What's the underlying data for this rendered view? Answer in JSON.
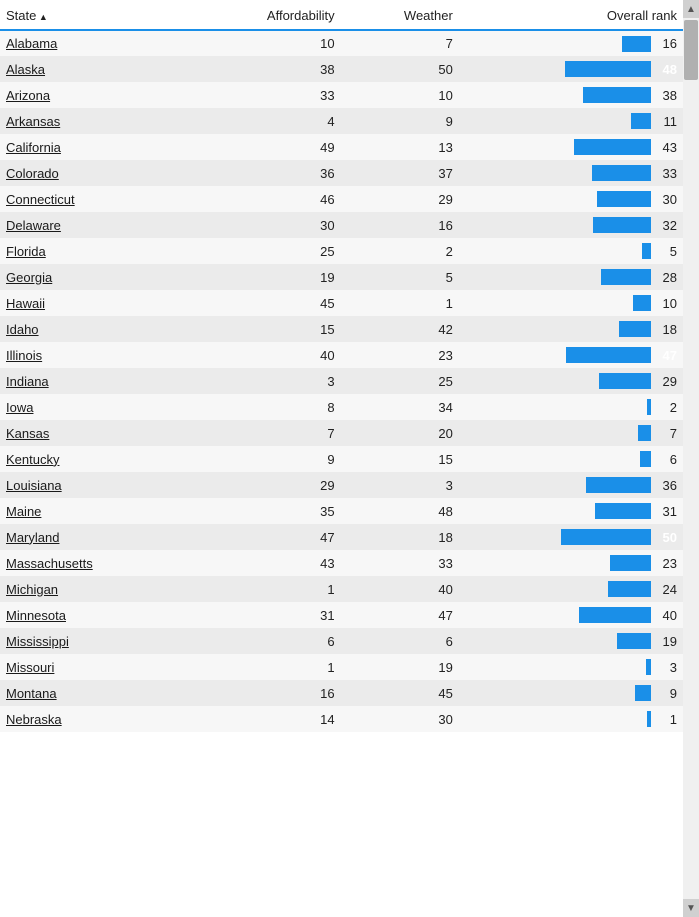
{
  "header": {
    "state_col": "State",
    "affordability_col": "Affordability",
    "weather_col": "Weather",
    "overall_col": "Overall rank"
  },
  "rows": [
    {
      "state": "Alabama",
      "affordability": 10,
      "weather": 7,
      "rank": 16
    },
    {
      "state": "Alaska",
      "affordability": 38,
      "weather": 50,
      "rank": 48
    },
    {
      "state": "Arizona",
      "affordability": 33,
      "weather": 10,
      "rank": 38
    },
    {
      "state": "Arkansas",
      "affordability": 4,
      "weather": 9,
      "rank": 11
    },
    {
      "state": "California",
      "affordability": 49,
      "weather": 13,
      "rank": 43
    },
    {
      "state": "Colorado",
      "affordability": 36,
      "weather": 37,
      "rank": 33
    },
    {
      "state": "Connecticut",
      "affordability": 46,
      "weather": 29,
      "rank": 30
    },
    {
      "state": "Delaware",
      "affordability": 30,
      "weather": 16,
      "rank": 32
    },
    {
      "state": "Florida",
      "affordability": 25,
      "weather": 2,
      "rank": 5
    },
    {
      "state": "Georgia",
      "affordability": 19,
      "weather": 5,
      "rank": 28
    },
    {
      "state": "Hawaii",
      "affordability": 45,
      "weather": 1,
      "rank": 10
    },
    {
      "state": "Idaho",
      "affordability": 15,
      "weather": 42,
      "rank": 18
    },
    {
      "state": "Illinois",
      "affordability": 40,
      "weather": 23,
      "rank": 47
    },
    {
      "state": "Indiana",
      "affordability": 3,
      "weather": 25,
      "rank": 29
    },
    {
      "state": "Iowa",
      "affordability": 8,
      "weather": 34,
      "rank": 2
    },
    {
      "state": "Kansas",
      "affordability": 7,
      "weather": 20,
      "rank": 7
    },
    {
      "state": "Kentucky",
      "affordability": 9,
      "weather": 15,
      "rank": 6
    },
    {
      "state": "Louisiana",
      "affordability": 29,
      "weather": 3,
      "rank": 36
    },
    {
      "state": "Maine",
      "affordability": 35,
      "weather": 48,
      "rank": 31
    },
    {
      "state": "Maryland",
      "affordability": 47,
      "weather": 18,
      "rank": 50
    },
    {
      "state": "Massachusetts",
      "affordability": 43,
      "weather": 33,
      "rank": 23
    },
    {
      "state": "Michigan",
      "affordability": 1,
      "weather": 40,
      "rank": 24
    },
    {
      "state": "Minnesota",
      "affordability": 31,
      "weather": 47,
      "rank": 40
    },
    {
      "state": "Mississippi",
      "affordability": 6,
      "weather": 6,
      "rank": 19
    },
    {
      "state": "Missouri",
      "affordability": 1,
      "weather": 19,
      "rank": 3
    },
    {
      "state": "Montana",
      "affordability": 16,
      "weather": 45,
      "rank": 9
    },
    {
      "state": "Nebraska",
      "affordability": 14,
      "weather": 30,
      "rank": 1
    }
  ],
  "max_rank": 50,
  "bar_max_width": 90
}
